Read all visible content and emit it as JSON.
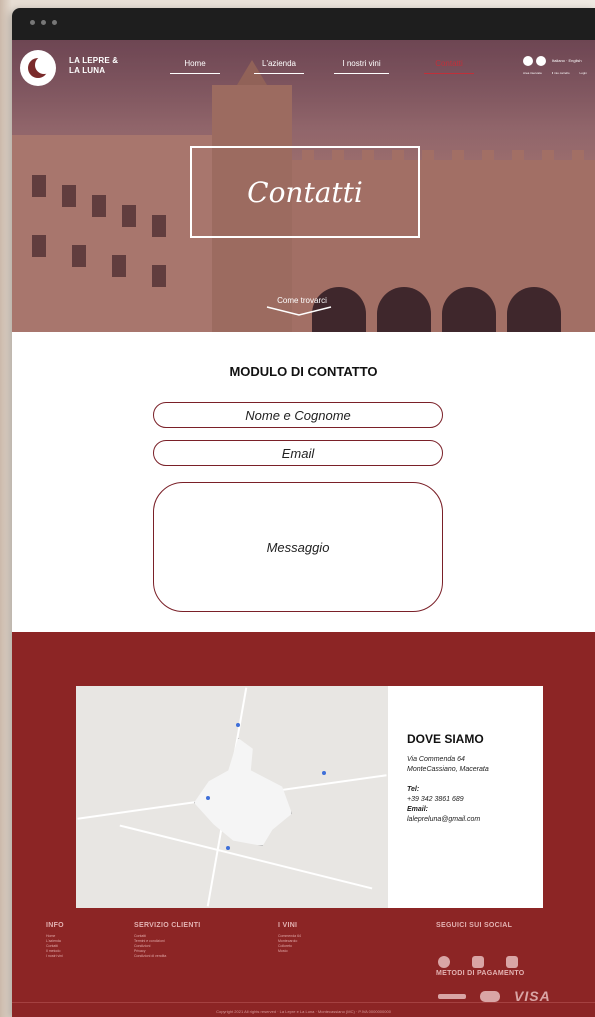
{
  "brand": {
    "line1": "LA LEPRE &",
    "line2": "LA LUNA"
  },
  "nav": {
    "items": [
      {
        "label": "Home"
      },
      {
        "label": "L'azienda"
      },
      {
        "label": "I nostri vini"
      },
      {
        "label": "Contatti"
      }
    ],
    "lang": "Italiano · English",
    "tiny_labels": [
      "Area riservata",
      "Il mio carrello",
      "Login"
    ]
  },
  "hero": {
    "title": "Contatti",
    "scroll_label": "Come trovarci"
  },
  "form": {
    "title": "MODULO DI CONTATTO",
    "name_placeholder": "Nome e Cognome",
    "email_placeholder": "Email",
    "message_placeholder": "Messaggio"
  },
  "location": {
    "title": "DOVE SIAMO",
    "address_line1": "Via Commenda 64",
    "address_line2": "MonteCassiano, Macerata",
    "tel_label": "Tel:",
    "tel": "+39 342 3861 689",
    "email_label": "Email:",
    "email": "lalepreluna@gmail.com"
  },
  "footer": {
    "info": {
      "title": "INFO",
      "items": [
        "Home",
        "L'azienda",
        "Contatti",
        "Il metodo",
        "I nostri vini"
      ]
    },
    "servizio": {
      "title": "SERVIZIO CLIENTI",
      "items": [
        "Contatti",
        "Termini e condizioni",
        "Condizioni",
        "Privacy",
        "Condizioni di vendita"
      ]
    },
    "vini": {
      "title": "I VINI",
      "items": [
        "Commenda 64",
        "Montecarolo",
        "Colloreto",
        "Mosto"
      ]
    },
    "social_title": "SEGUICI SUI SOCIAL",
    "payment_title": "METODI DI PAGAMENTO",
    "visa": "VISA",
    "copyright": "Copyright 2021 All rights reserved · La Lepre e La Luna · Montecassiano (MC) · P.IVA 0000000000"
  },
  "colors": {
    "accent": "#8c2525",
    "active_nav": "#c0303a",
    "field_border": "#7a2028"
  }
}
